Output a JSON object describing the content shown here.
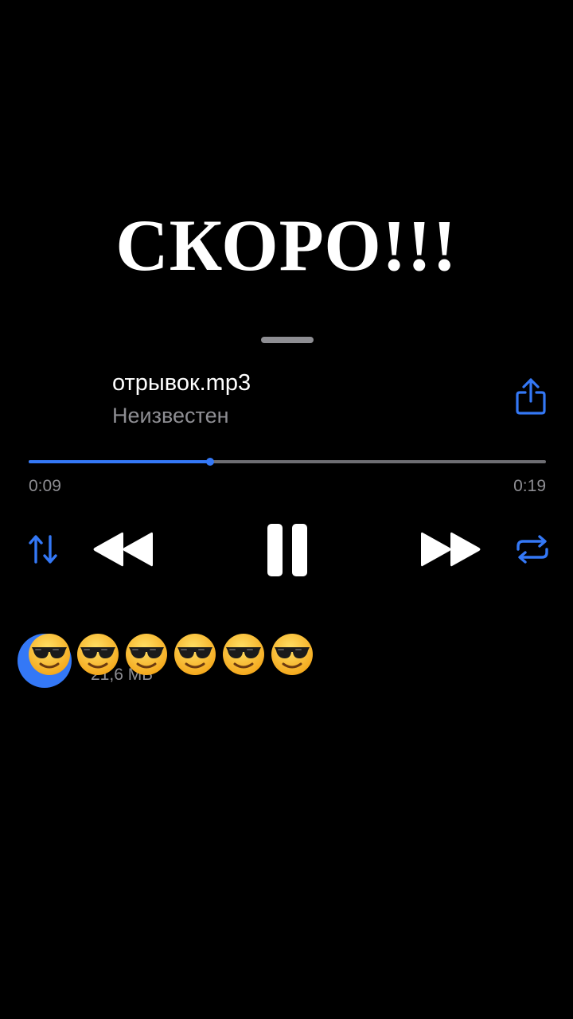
{
  "overlay": {
    "headline": "СКОРО!!!",
    "emoji_count": 6,
    "emoji_icon": "smiling-face-with-sunglasses"
  },
  "player": {
    "title": "отрывок.mp3",
    "artist": "Неизвестен",
    "elapsed": "0:09",
    "total": "0:19",
    "progress_fraction": 0.35,
    "share_icon": "share-icon",
    "controls": {
      "shuffle_icon": "sort-arrows-icon",
      "rewind_icon": "rewind-icon",
      "pause_icon": "pause-icon",
      "forward_icon": "fast-forward-icon",
      "repeat_icon": "repeat-icon"
    }
  },
  "file": {
    "size": "21,6 МБ"
  },
  "colors": {
    "background": "#000000",
    "accent": "#3478f6",
    "secondary_text": "#8e8e93",
    "track": "#6e6e73"
  }
}
